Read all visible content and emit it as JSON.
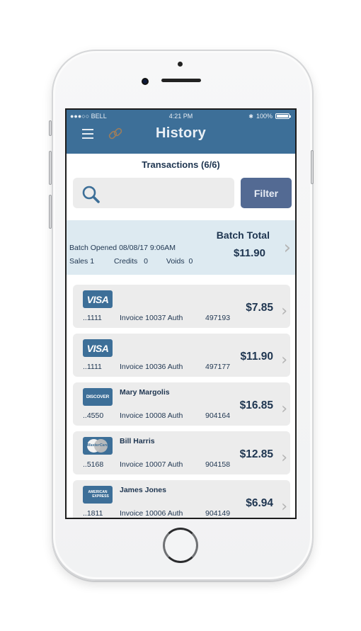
{
  "status_bar": {
    "carrier": "●●●○○ BELL",
    "time": "4:21 PM",
    "bluetooth": "✱",
    "battery": "100%"
  },
  "header": {
    "title": "History",
    "menu_icon": "menu-icon",
    "link_icon": "link-icon"
  },
  "transactions_heading": "Transactions (6/6)",
  "search": {
    "value": "",
    "placeholder": ""
  },
  "filter_label": "Filter",
  "batch": {
    "opened_label": "Batch Opened",
    "opened_value": "08/08/17 9:06AM",
    "sales_label": "Sales",
    "sales_value": "1",
    "credits_label": "Credits",
    "credits_value": "0",
    "voids_label": "Voids",
    "voids_value": "0",
    "total_label": "Batch Total",
    "total_value": "$11.90"
  },
  "transactions": [
    {
      "card_brand": "VISA",
      "holder": "",
      "last4": "..1111",
      "invoice": "Invoice 10037  Auth",
      "auth": "497193",
      "amount": "$7.85"
    },
    {
      "card_brand": "VISA",
      "holder": "",
      "last4": "..1111",
      "invoice": "Invoice 10036  Auth",
      "auth": "497177",
      "amount": "$11.90"
    },
    {
      "card_brand": "DISCOVER",
      "holder": "Mary Margolis",
      "last4": "..4550",
      "invoice": "Invoice 10008  Auth",
      "auth": "904164",
      "amount": "$16.85"
    },
    {
      "card_brand": "MasterCard",
      "holder": "Bill Harris",
      "last4": "..5168",
      "invoice": "Invoice 10007  Auth",
      "auth": "904158",
      "amount": "$12.85"
    },
    {
      "card_brand_line1": "AMERICAN",
      "card_brand_line2": "EXPRESS",
      "holder": "James Jones",
      "last4": "..1811",
      "invoice": "Invoice 10006  Auth",
      "auth": "904149",
      "amount": "$6.94"
    }
  ],
  "chevron": "›",
  "colors": {
    "header_bg": "#3d6f98",
    "filter_bg": "#536a93",
    "batch_bg": "#ddeaf1",
    "row_bg": "#ececec",
    "text_primary": "#1e3550"
  }
}
